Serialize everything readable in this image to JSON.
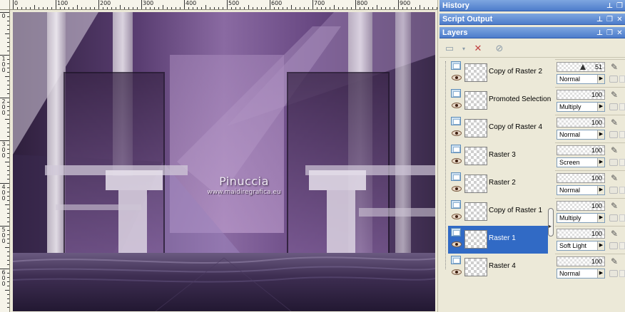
{
  "rulers": {
    "top_labels": [
      "0",
      "100",
      "200",
      "300",
      "400",
      "500",
      "600",
      "700",
      "800",
      "900"
    ],
    "left_labels": [
      "0",
      "100",
      "200",
      "300",
      "400",
      "500",
      "600"
    ]
  },
  "canvas": {
    "watermark_name": "Pinuccia",
    "watermark_url": "www.maidiregrafica.eu"
  },
  "panels": {
    "history_title": "History",
    "script_output_title": "Script Output",
    "layers_title": "Layers"
  },
  "layers": [
    {
      "name": "Copy of Raster 2",
      "opacity": "51",
      "blend": "Normal",
      "selected": false
    },
    {
      "name": "Promoted Selection",
      "opacity": "100",
      "blend": "Multiply",
      "selected": false
    },
    {
      "name": "Copy of Raster 4",
      "opacity": "100",
      "blend": "Normal",
      "selected": false
    },
    {
      "name": "Raster 3",
      "opacity": "100",
      "blend": "Screen",
      "selected": false
    },
    {
      "name": "Raster 2",
      "opacity": "100",
      "blend": "Normal",
      "selected": false
    },
    {
      "name": "Copy of Raster 1",
      "opacity": "100",
      "blend": "Multiply",
      "selected": false
    },
    {
      "name": "Raster 1",
      "opacity": "100",
      "blend": "Soft Light",
      "selected": true
    },
    {
      "name": "Raster 4",
      "opacity": "100",
      "blend": "Normal",
      "selected": false
    }
  ],
  "colors": {
    "header_blue": "#4d7ccb",
    "selected_blue": "#316ac5",
    "purple_dark": "#3a2648",
    "purple_mid": "#6a4a80",
    "purple_light": "#b79ac8"
  }
}
